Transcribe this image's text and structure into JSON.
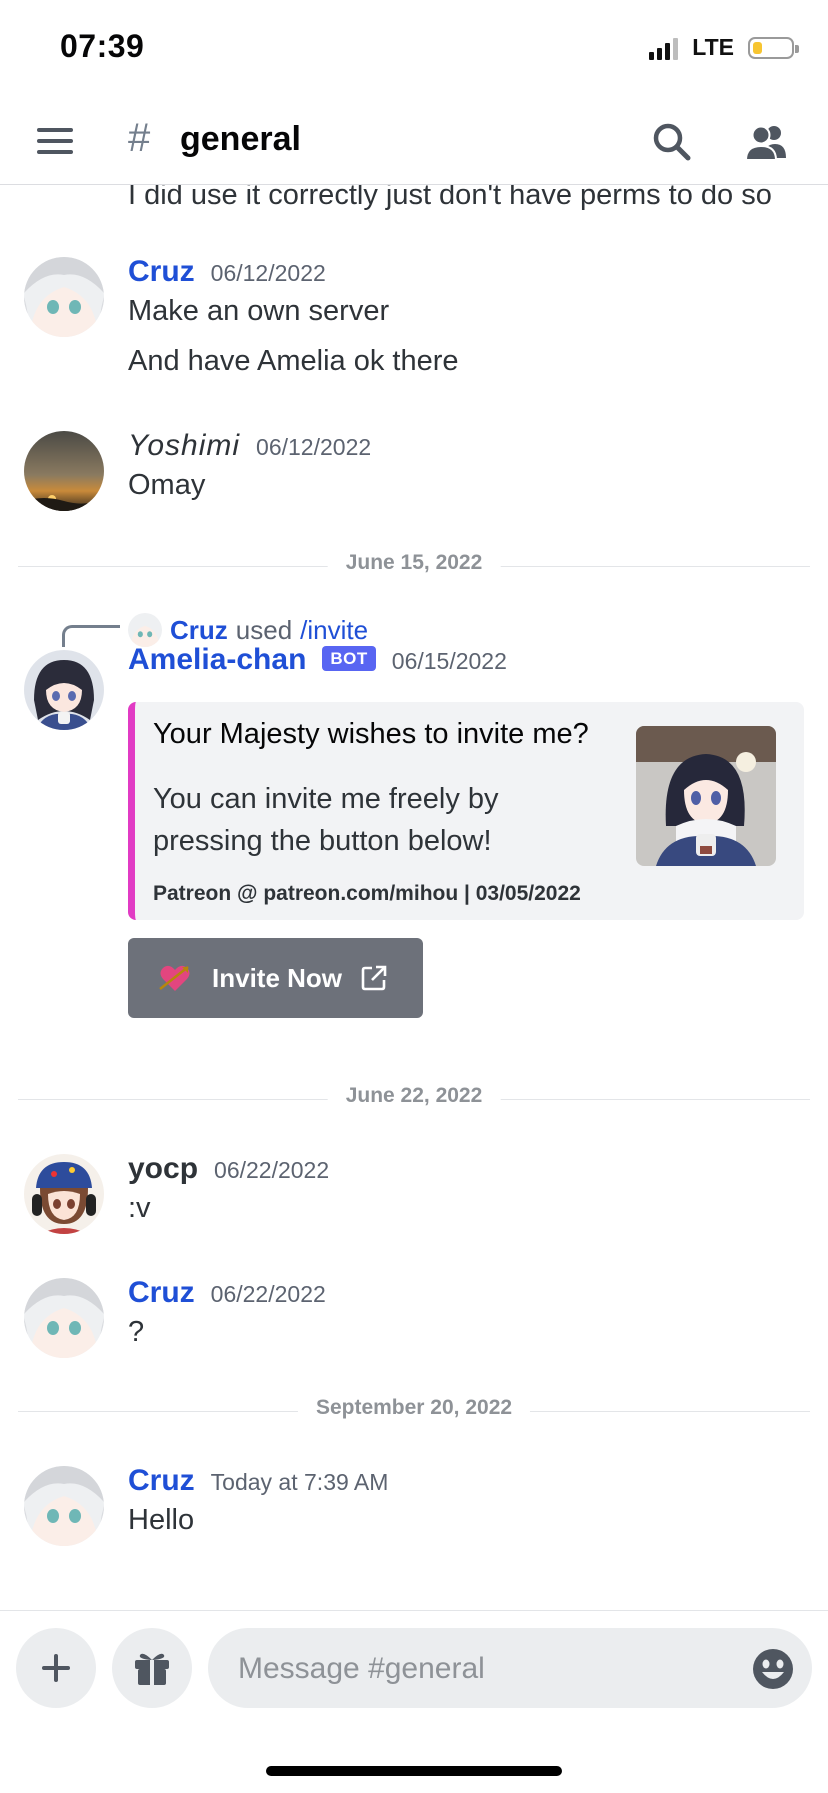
{
  "status_bar": {
    "time": "07:39",
    "network": "LTE",
    "battery_level": 0.25
  },
  "header": {
    "hash": "#",
    "channel": "general"
  },
  "chat": {
    "continuation_text": "I did use it correctly just don't have perms to do so",
    "messages": [
      {
        "author": "Cruz",
        "author_color": "#1f4fd6",
        "timestamp": "06/12/2022",
        "lines": [
          "Make an own server",
          "And have Amelia ok there"
        ]
      },
      {
        "author": "Yoshimi",
        "author_color": "#2e3338",
        "timestamp": "06/12/2022",
        "lines": [
          "Omay"
        ]
      }
    ],
    "dividers": [
      "June 15, 2022",
      "June 22, 2022",
      "September 20, 2022"
    ],
    "bot_message": {
      "reply_user": "Cruz",
      "reply_used": "used",
      "reply_command": "/invite",
      "author": "Amelia-chan",
      "author_color": "#1f4fd6",
      "bot_tag": "BOT",
      "timestamp": "06/15/2022",
      "embed": {
        "accent_color": "#e13bc4",
        "title": "Your Majesty wishes to invite me?",
        "description": "You can invite me freely by pressing the button below!",
        "footer": "Patreon @ patreon.com/mihou | 03/05/2022"
      },
      "button_label": "Invite Now"
    },
    "later_messages": [
      {
        "author": "yocp",
        "author_color": "#2e3338",
        "timestamp": "06/22/2022",
        "text": ":v"
      },
      {
        "author": "Cruz",
        "author_color": "#1f4fd6",
        "timestamp": "06/22/2022",
        "text": "?"
      },
      {
        "author": "Cruz",
        "author_color": "#1f4fd6",
        "timestamp": "Today at 7:39 AM",
        "text": "Hello"
      }
    ]
  },
  "composer": {
    "placeholder": "Message #general"
  },
  "icons": {
    "menu": "hamburger-icon",
    "search": "search-icon",
    "members": "members-icon",
    "add": "plus-icon",
    "gift": "gift-icon",
    "emoji": "emoji-icon",
    "external": "external-link-icon"
  }
}
